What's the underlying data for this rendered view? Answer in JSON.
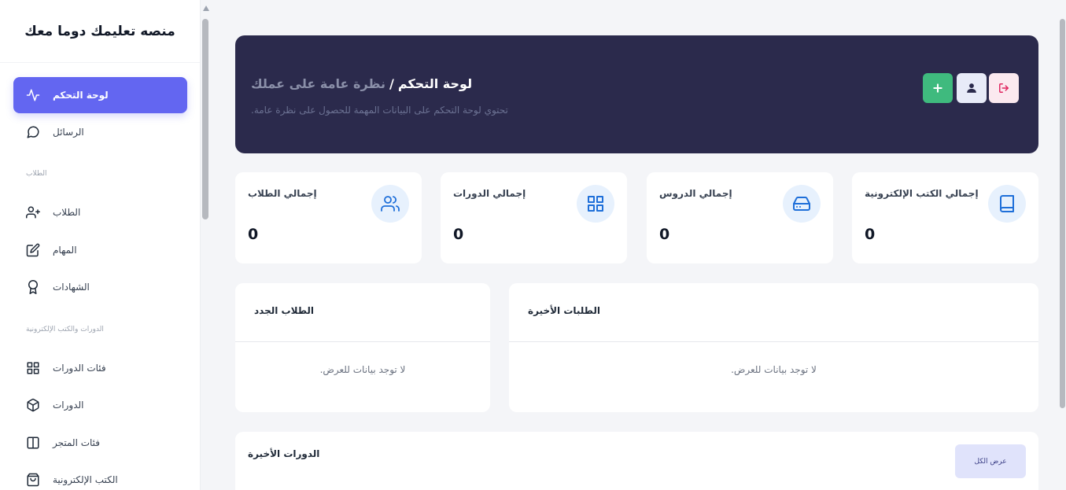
{
  "brand": "منصه تعليمك دوما معك",
  "sidebar": {
    "items": [
      {
        "label": "لوحة التحكم",
        "icon": "activity-icon"
      },
      {
        "label": "الرسائل",
        "icon": "message-circle-icon"
      },
      {
        "label": "الطلاب",
        "icon": "user-plus-icon"
      },
      {
        "label": "المهام",
        "icon": "edit-icon"
      },
      {
        "label": "الشهادات",
        "icon": "award-icon"
      },
      {
        "label": "فئات الدورات",
        "icon": "grid-icon"
      },
      {
        "label": "الدورات",
        "icon": "box-icon"
      },
      {
        "label": "فئات المتجر",
        "icon": "columns-icon"
      },
      {
        "label": "الكتب الإلكترونية",
        "icon": "shopping-bag-icon"
      }
    ],
    "sections": {
      "students": "الطلاب",
      "courses": "الدورات والكتب الإلكترونية"
    }
  },
  "hero": {
    "title_main": "لوحة التحكم",
    "separator": "/",
    "title_sub": "نظرة عامة على عملك",
    "description": "تحتوي لوحة التحكم على البيانات المهمة للحصول على نظرة عامة.",
    "buttons": {
      "add": "plus-icon",
      "user": "user-icon",
      "logout": "sign-out-icon"
    },
    "colors": {
      "background": "#2b2a4c",
      "add": "#3fba7e",
      "logout_icon": "#e0245e"
    }
  },
  "stats": [
    {
      "label": "إجمالي الطلاب",
      "value": "0",
      "icon": "users-icon"
    },
    {
      "label": "إجمالي الدورات",
      "value": "0",
      "icon": "grid-icon"
    },
    {
      "label": "إجمالي الدروس",
      "value": "0",
      "icon": "hard-drive-icon"
    },
    {
      "label": "إجمالي الكتب الإلكترونية",
      "value": "0",
      "icon": "book-icon"
    }
  ],
  "panels": {
    "new_students": {
      "title": "الطلاب الجدد",
      "empty": "لا توجد بيانات للعرض."
    },
    "recent_orders": {
      "title": "الطلبات الأخيرة",
      "empty": "لا توجد بيانات للعرض."
    }
  },
  "courses": {
    "title": "الدورات الأخيرة",
    "view_all": "عرض الكل"
  },
  "accent_color": "#6366f1"
}
